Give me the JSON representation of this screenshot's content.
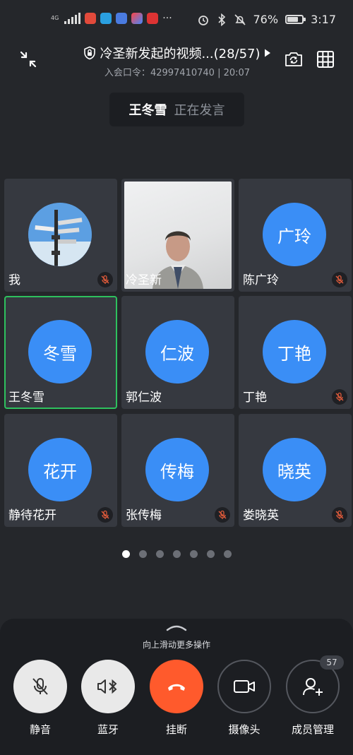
{
  "status_bar": {
    "network": "4G",
    "battery_percent": "76%",
    "battery_level": 0.76,
    "time": "3:17",
    "overflow": "···"
  },
  "header": {
    "title": "冷圣新发起的视频...(28/57)",
    "meeting_code_label": "入会口令：",
    "meeting_code": "42997410740",
    "elapsed": "20:07",
    "separator": "|"
  },
  "speaker": {
    "name": "王冬雪",
    "status": "正在发言"
  },
  "participants": [
    {
      "name": "我",
      "initials": "",
      "type": "photo",
      "muted": true,
      "active": false
    },
    {
      "name": "冷圣新",
      "initials": "",
      "type": "video",
      "muted": false,
      "active": false
    },
    {
      "name": "陈广玲",
      "initials": "广玲",
      "type": "avatar",
      "muted": true,
      "active": false
    },
    {
      "name": "王冬雪",
      "initials": "冬雪",
      "type": "avatar",
      "muted": false,
      "active": true
    },
    {
      "name": "郭仁波",
      "initials": "仁波",
      "type": "avatar",
      "muted": false,
      "active": false
    },
    {
      "name": "丁艳",
      "initials": "丁艳",
      "type": "avatar",
      "muted": true,
      "active": false
    },
    {
      "name": "静待花开",
      "initials": "花开",
      "type": "avatar",
      "muted": true,
      "active": false
    },
    {
      "name": "张传梅",
      "initials": "传梅",
      "type": "avatar",
      "muted": true,
      "active": false
    },
    {
      "name": "娄晓英",
      "initials": "晓英",
      "type": "avatar",
      "muted": true,
      "active": false
    }
  ],
  "pagination": {
    "pages": 7,
    "current": 1
  },
  "panel": {
    "hint": "向上滑动更多操作",
    "controls": {
      "mute": "静音",
      "bluetooth": "蓝牙",
      "hangup": "挂断",
      "camera": "摄像头",
      "members": "成员管理"
    },
    "member_count": "57"
  },
  "colors": {
    "background": "#25272b",
    "tile": "#363940",
    "avatar": "#3a8ef6",
    "active_border": "#2ec15e",
    "hangup": "#ff5a2c"
  }
}
